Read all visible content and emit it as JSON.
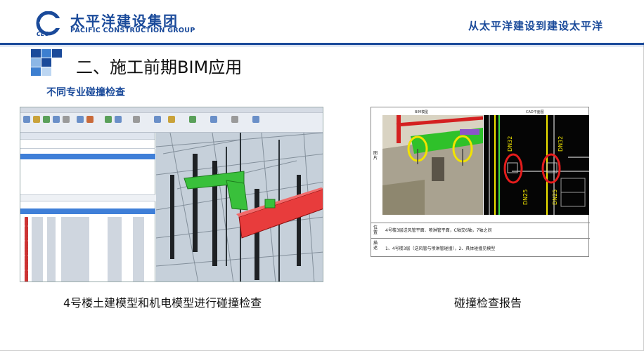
{
  "header": {
    "company_cn": "太平洋建设集团",
    "company_en": "PACIFIC CONSTRUCTION GROUP",
    "logo_text": "CEO",
    "slogan": "从太平洋建设到建设太平洋",
    "brand_color": "#1a4a9a"
  },
  "title": "二、施工前期BIM应用",
  "subtitle": "不同专业碰撞检查",
  "left_figure": {
    "caption": "4号楼土建模型和机电模型进行碰撞检查"
  },
  "right_figure": {
    "caption": "碰撞检查报告",
    "col_bim": "BIM模型",
    "col_cad": "CAD平面图",
    "row_image": "图片",
    "row_location": "位置",
    "row_desc": "描述",
    "location_text": "4号楼3层送风管平面、喷淋管平面，C轴交6轴，7轴之间",
    "desc_text": "1、4号楼3层（送风管与喷淋管碰撞），2、具体碰撞见模型",
    "cad_labels": [
      "DN32",
      "DN25",
      "DN25",
      "DN32"
    ]
  },
  "icons": [
    "ceo-logo-icon",
    "blue-mosaic-icon"
  ]
}
